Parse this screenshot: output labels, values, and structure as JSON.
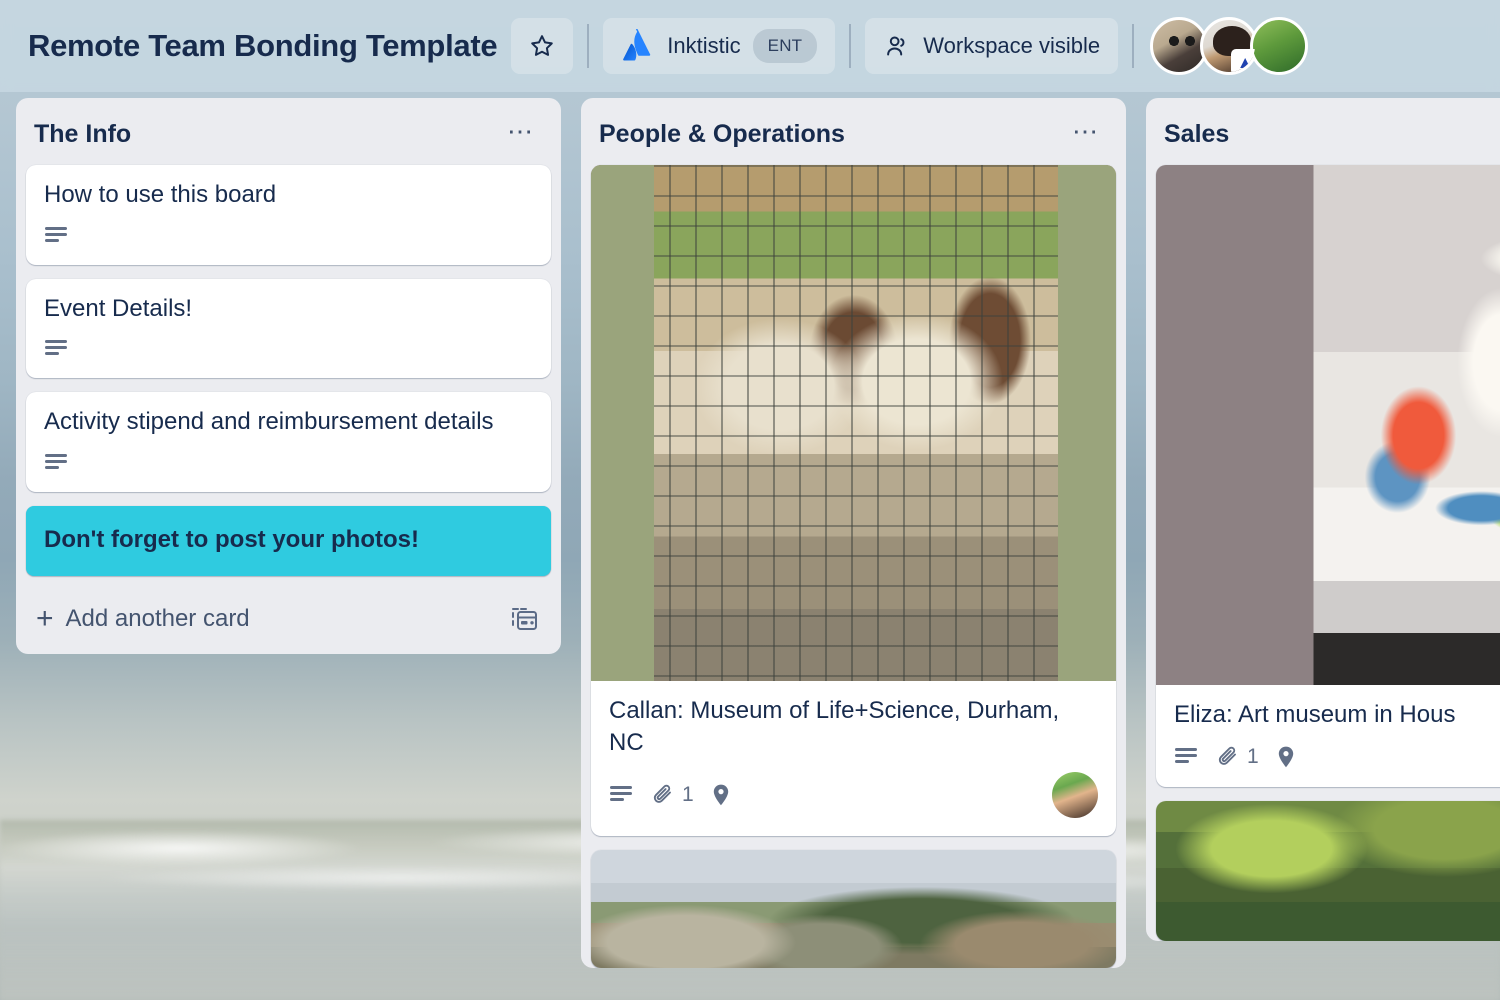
{
  "header": {
    "board_title": "Remote Team Bonding Template",
    "star_icon": "star-icon",
    "workspace": {
      "logo_icon": "atlassian-logo-icon",
      "name": "Inktistic",
      "plan_badge": "ENT"
    },
    "visibility": {
      "icon": "people-icon",
      "label": "Workspace visible"
    },
    "members": [
      {
        "name": "member-1",
        "badge": null
      },
      {
        "name": "member-2",
        "badge": "chevrons-up-icon"
      },
      {
        "name": "member-3",
        "badge": null
      }
    ]
  },
  "lists": [
    {
      "title": "The Info",
      "menu_icon": "ellipsis-icon",
      "cards": [
        {
          "title": "How to use this board",
          "cover": null,
          "highlight": false,
          "badges": {
            "description": true,
            "attachments": null,
            "location": false,
            "member": false
          }
        },
        {
          "title": "Event Details!",
          "cover": null,
          "highlight": false,
          "badges": {
            "description": true,
            "attachments": null,
            "location": false,
            "member": false
          }
        },
        {
          "title": "Activity stipend and reimbursement details",
          "cover": null,
          "highlight": false,
          "badges": {
            "description": true,
            "attachments": null,
            "location": false,
            "member": false
          }
        },
        {
          "title": "Don't forget to post your photos!",
          "cover": null,
          "highlight": true,
          "badges": {
            "description": false,
            "attachments": null,
            "location": false,
            "member": false
          }
        }
      ],
      "add_card": {
        "label": "Add another card",
        "plus_icon": "plus-icon",
        "template_icon": "card-template-icon"
      }
    },
    {
      "title": "People & Operations",
      "menu_icon": "ellipsis-icon",
      "cards": [
        {
          "title": "Callan: Museum of Life+Science, Durham, NC",
          "cover": "cows-in-pen-photo",
          "highlight": false,
          "badges": {
            "description": true,
            "attachments": "1",
            "location": true,
            "member": true
          }
        },
        {
          "title": "",
          "cover": "castle-manor-photo",
          "highlight": false,
          "badges": {
            "description": false,
            "attachments": null,
            "location": false,
            "member": false
          }
        }
      ],
      "add_card": null
    },
    {
      "title": "Sales",
      "menu_icon": null,
      "cards": [
        {
          "title": "Eliza: Art museum in Hous",
          "cover": "crochet-snake-sculpture-photo",
          "highlight": false,
          "badges": {
            "description": true,
            "attachments": "1",
            "location": true,
            "member": false
          }
        },
        {
          "title": "",
          "cover": "selfie-in-nature-photo",
          "highlight": false,
          "badges": {
            "description": false,
            "attachments": null,
            "location": false,
            "member": false
          }
        }
      ],
      "add_card": null
    }
  ],
  "colors": {
    "header_bg": "#c6d7e1",
    "list_bg": "#ebecf0",
    "card_bg": "#ffffff",
    "text_primary": "#172b4d",
    "text_muted": "#626f86",
    "highlight_card": "#2fcbe0",
    "atlassian_blue": "#2684ff"
  }
}
